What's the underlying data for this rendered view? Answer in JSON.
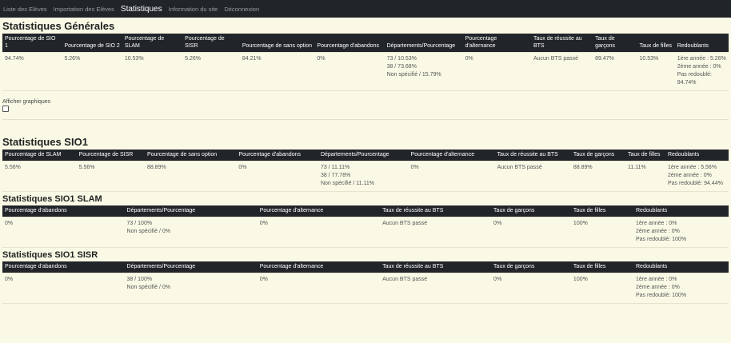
{
  "nav": {
    "items": [
      "Liste des Elèves",
      "Importation des Elèves",
      "Statistiques",
      "Information du site",
      "Déconnexion"
    ],
    "active_index": 2
  },
  "general": {
    "title": "Statistiques Générales",
    "headers": [
      "Pourcentage de SIO 1",
      "Pourcentage de SIO 2",
      "Pourcentage de SLAM",
      "Pourcentage de SISR",
      "Pourcentage de sans option",
      "Pourcentage d'abandons",
      "Départements/Pourcentage",
      "Pourcentage d'alternance",
      "Taux de réussite au BTS",
      "Taux de garçons",
      "Taux de filles",
      "Redoublants"
    ],
    "row": [
      [
        "94.74%"
      ],
      [
        "5.26%"
      ],
      [
        "10.53%"
      ],
      [
        "5.26%"
      ],
      [
        "84.21%"
      ],
      [
        "0%"
      ],
      [
        "73 / 10.53%",
        "38 / 73.68%",
        "Non spécifié / 15.79%"
      ],
      [
        "0%"
      ],
      [
        "Aucun BTS passé"
      ],
      [
        "89.47%"
      ],
      [
        "10.53%"
      ],
      [
        "1ère année : 5.26%",
        "2ème année : 0%",
        "Pas redoublé:",
        "94.74%"
      ]
    ]
  },
  "graphs": {
    "label": "Afficher graphiques",
    "checked": false
  },
  "sio1": {
    "title": "Statistiques SIO1",
    "headers": [
      "Pourcentage de SLAM",
      "Pourcentage de SISR",
      "Pourcentage de sans option",
      "Pourcentage d'abandons",
      "Départements/Pourcentage",
      "Pourcentage d'alternance",
      "Taux de réussite au BTS",
      "Taux de garçons",
      "Taux de filles",
      "Redoublants"
    ],
    "row": [
      [
        "5.56%"
      ],
      [
        "5.56%"
      ],
      [
        "88.89%"
      ],
      [
        "0%"
      ],
      [
        "73 / 11.11%",
        "38 / 77.78%",
        "Non spécifié / 11.11%"
      ],
      [
        "0%"
      ],
      [
        "Aucun BTS passé"
      ],
      [
        "88.89%"
      ],
      [
        "11.11%"
      ],
      [
        "1ère année : 5.56%",
        "2ème année : 0%",
        "Pas redoublé: 94.44%"
      ]
    ]
  },
  "sio1_slam": {
    "title": "Statistiques SIO1 SLAM",
    "headers": [
      "Pourcentage d'abandons",
      "Départements/Pourcentage",
      "Pourcentage d'alternance",
      "Taux de réussite au BTS",
      "Taux de garçons",
      "Taux de filles",
      "Redoublants"
    ],
    "row": [
      [
        "0%"
      ],
      [
        "73 / 100%",
        "Non spécifié / 0%"
      ],
      [
        "0%"
      ],
      [
        "Aucun BTS passé"
      ],
      [
        "0%"
      ],
      [
        "100%"
      ],
      [
        "1ère année : 0%",
        "2ème année : 0%",
        "Pas redoublé: 100%"
      ]
    ]
  },
  "sio1_sisr": {
    "title": "Statistiques SIO1 SISR",
    "headers": [
      "Pourcentage d'abandons",
      "Départements/Pourcentage",
      "Pourcentage d'alternance",
      "Taux de réussite au BTS",
      "Taux de garçons",
      "Taux de filles",
      "Redoublants"
    ],
    "row": [
      [
        "0%"
      ],
      [
        "38 / 100%",
        "Non spécifié / 0%"
      ],
      [
        "0%"
      ],
      [
        "Aucun BTS passé"
      ],
      [
        "0%"
      ],
      [
        "100%"
      ],
      [
        "1ère année : 0%",
        "2ème année : 0%",
        "Pas redoublé: 100%"
      ]
    ]
  }
}
